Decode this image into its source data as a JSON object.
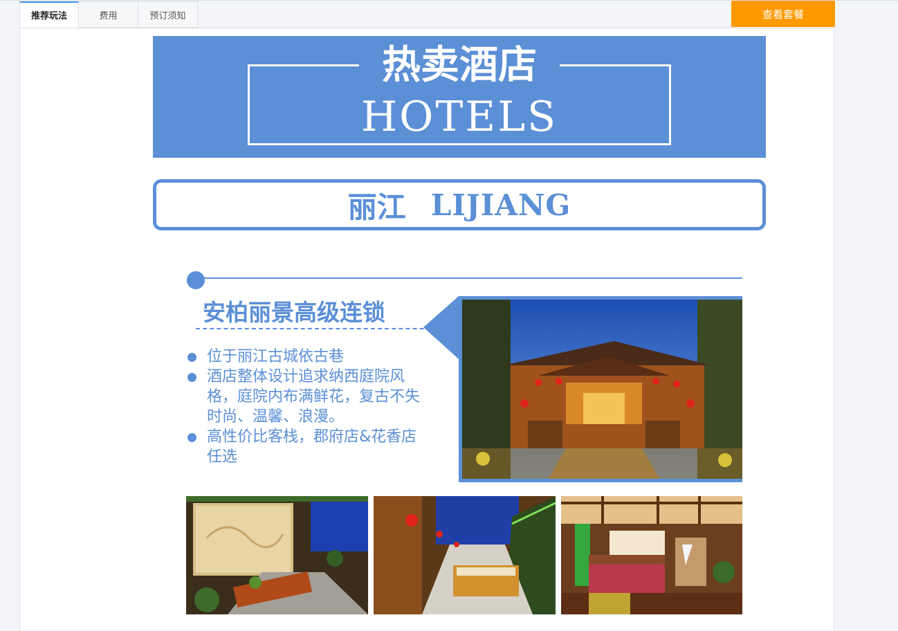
{
  "tabs": [
    {
      "label": "推荐玩法",
      "active": true
    },
    {
      "label": "费用",
      "active": false
    },
    {
      "label": "预订须知",
      "active": false
    }
  ],
  "cta": {
    "label": "查看套餐",
    "color": "#ff9900"
  },
  "accent_color": "#5b8fd6",
  "banner": {
    "title_cn": "热卖酒店",
    "title_en": "HOTELS"
  },
  "city": {
    "name_cn": "丽江",
    "name_en": "LIJIANG"
  },
  "hotel": {
    "name": "安柏丽景高级连锁",
    "bullets": [
      "位于丽江古城依古巷",
      "酒店整体设计追求纳西庭院风格，庭院内布满鲜花，复古不失时尚、温馨、浪漫。",
      "高性价比客栈，郡府店&花香店任选"
    ]
  },
  "photos": [
    {
      "subject": "hotel-facade-night"
    },
    {
      "subject": "courtyard-mural-dining"
    },
    {
      "subject": "courtyard-corridor-lanterns"
    },
    {
      "subject": "guest-room"
    }
  ]
}
